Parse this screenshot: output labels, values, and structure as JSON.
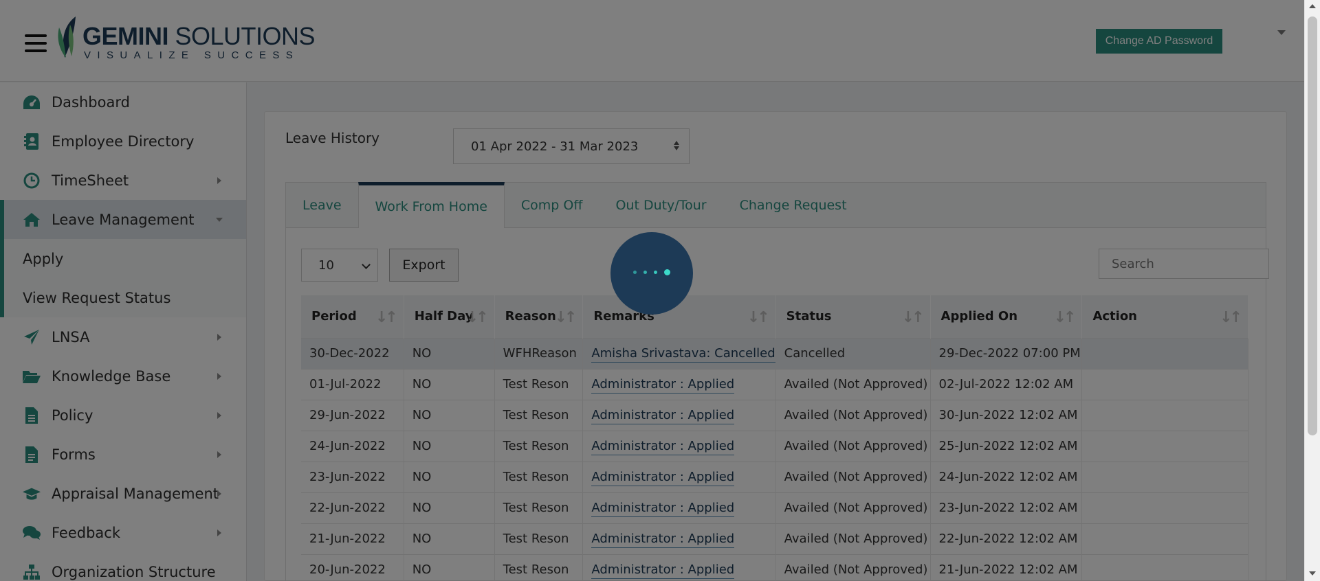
{
  "header": {
    "logo": {
      "brand_bold": "GEMINI",
      "brand_rest": " SOLUTIONS",
      "tagline": "VISUALIZE SUCCESS"
    },
    "change_ad_password": "Change AD Password"
  },
  "sidebar": {
    "items": [
      {
        "label": "Dashboard",
        "icon": "dashboard-icon",
        "has_children": false
      },
      {
        "label": "Employee Directory",
        "icon": "address-book-icon",
        "has_children": false
      },
      {
        "label": "TimeSheet",
        "icon": "clock-icon",
        "has_children": true
      },
      {
        "label": "Leave Management",
        "icon": "home-icon",
        "has_children": true,
        "expanded": true
      },
      {
        "label": "LNSA",
        "icon": "paper-plane-icon",
        "has_children": true
      },
      {
        "label": "Knowledge Base",
        "icon": "folder-open-icon",
        "has_children": true
      },
      {
        "label": "Policy",
        "icon": "file-text-icon",
        "has_children": true
      },
      {
        "label": "Forms",
        "icon": "file-form-icon",
        "has_children": true
      },
      {
        "label": "Appraisal Management",
        "icon": "graduation-cap-icon",
        "has_children": true
      },
      {
        "label": "Feedback",
        "icon": "comments-icon",
        "has_children": true
      },
      {
        "label": "Organization Structure",
        "icon": "sitemap-icon",
        "has_children": false
      }
    ],
    "leave_subitems": [
      {
        "label": "Apply"
      },
      {
        "label": "View Request Status"
      }
    ]
  },
  "main": {
    "title": "Leave History",
    "financial_year": "01 Apr 2022 - 31 Mar 2023",
    "tabs": [
      {
        "label": "Leave",
        "active": false
      },
      {
        "label": "Work From Home",
        "active": true
      },
      {
        "label": "Comp Off",
        "active": false
      },
      {
        "label": "Out Duty/Tour",
        "active": false
      },
      {
        "label": "Change Request",
        "active": false
      }
    ],
    "page_length": "10",
    "export_label": "Export",
    "search_placeholder": "Search",
    "table": {
      "columns": [
        "Period",
        "Half Day",
        "Reason",
        "Remarks",
        "Status",
        "Applied On",
        "Action"
      ],
      "rows": [
        [
          "30-Dec-2022",
          "NO",
          "WFHReason",
          "Amisha Srivastava: Cancelled",
          "Cancelled",
          "29-Dec-2022 07:00 PM",
          ""
        ],
        [
          "01-Jul-2022",
          "NO",
          "Test Reson",
          "Administrator : Applied",
          "Availed (Not Approved)",
          "02-Jul-2022 12:02 AM",
          ""
        ],
        [
          "29-Jun-2022",
          "NO",
          "Test Reson",
          "Administrator : Applied",
          "Availed (Not Approved)",
          "30-Jun-2022 12:02 AM",
          ""
        ],
        [
          "24-Jun-2022",
          "NO",
          "Test Reson",
          "Administrator : Applied",
          "Availed (Not Approved)",
          "25-Jun-2022 12:02 AM",
          ""
        ],
        [
          "23-Jun-2022",
          "NO",
          "Test Reson",
          "Administrator : Applied",
          "Availed (Not Approved)",
          "24-Jun-2022 12:02 AM",
          ""
        ],
        [
          "22-Jun-2022",
          "NO",
          "Test Reson",
          "Administrator : Applied",
          "Availed (Not Approved)",
          "23-Jun-2022 12:02 AM",
          ""
        ],
        [
          "21-Jun-2022",
          "NO",
          "Test Reson",
          "Administrator : Applied",
          "Availed (Not Approved)",
          "22-Jun-2022 12:02 AM",
          ""
        ],
        [
          "20-Jun-2022",
          "NO",
          "Test Reson",
          "Administrator : Applied",
          "Availed (Not Approved)",
          "21-Jun-2022 12:02 AM",
          ""
        ]
      ]
    }
  },
  "colors": {
    "accent": "#2b8c7e",
    "navy": "#1d3a56",
    "loader_dot": "#3cd9c9",
    "overlay": "rgba(0,0,0,0.5)"
  }
}
